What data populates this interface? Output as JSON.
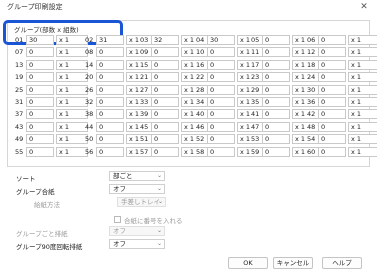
{
  "window": {
    "title": "グループ印刷設定",
    "close_glyph": "✕"
  },
  "group": {
    "legend": "グループ(部数 x 組数)",
    "rows": [
      [
        {
          "n": "01",
          "a": "30",
          "b": "x 1"
        },
        {
          "n": "02",
          "a": "31",
          "b": "x 1"
        },
        {
          "n": "03",
          "a": "32",
          "b": "x 1"
        },
        {
          "n": "04",
          "a": "30",
          "b": "x 1"
        },
        {
          "n": "05",
          "a": "0",
          "b": "x 1"
        },
        {
          "n": "06",
          "a": "0",
          "b": "x 1"
        }
      ],
      [
        {
          "n": "07",
          "a": "0",
          "b": "x 1"
        },
        {
          "n": "08",
          "a": "0",
          "b": "x 1"
        },
        {
          "n": "09",
          "a": "0",
          "b": "x 1"
        },
        {
          "n": "10",
          "a": "0",
          "b": "x 1"
        },
        {
          "n": "11",
          "a": "0",
          "b": "x 1"
        },
        {
          "n": "12",
          "a": "0",
          "b": "x 1"
        }
      ],
      [
        {
          "n": "13",
          "a": "0",
          "b": "x 1"
        },
        {
          "n": "14",
          "a": "0",
          "b": "x 1"
        },
        {
          "n": "15",
          "a": "0",
          "b": "x 1"
        },
        {
          "n": "16",
          "a": "0",
          "b": "x 1"
        },
        {
          "n": "17",
          "a": "0",
          "b": "x 1"
        },
        {
          "n": "18",
          "a": "0",
          "b": "x 1"
        }
      ],
      [
        {
          "n": "19",
          "a": "0",
          "b": "x 1"
        },
        {
          "n": "20",
          "a": "0",
          "b": "x 1"
        },
        {
          "n": "21",
          "a": "0",
          "b": "x 1"
        },
        {
          "n": "22",
          "a": "0",
          "b": "x 1"
        },
        {
          "n": "23",
          "a": "0",
          "b": "x 1"
        },
        {
          "n": "24",
          "a": "0",
          "b": "x 1"
        }
      ],
      [
        {
          "n": "25",
          "a": "0",
          "b": "x 1"
        },
        {
          "n": "26",
          "a": "0",
          "b": "x 1"
        },
        {
          "n": "27",
          "a": "0",
          "b": "x 1"
        },
        {
          "n": "28",
          "a": "0",
          "b": "x 1"
        },
        {
          "n": "29",
          "a": "0",
          "b": "x 1"
        },
        {
          "n": "30",
          "a": "0",
          "b": "x 1"
        }
      ],
      [
        {
          "n": "31",
          "a": "0",
          "b": "x 1"
        },
        {
          "n": "32",
          "a": "0",
          "b": "x 1"
        },
        {
          "n": "33",
          "a": "0",
          "b": "x 1"
        },
        {
          "n": "34",
          "a": "0",
          "b": "x 1"
        },
        {
          "n": "35",
          "a": "0",
          "b": "x 1"
        },
        {
          "n": "36",
          "a": "0",
          "b": "x 1"
        }
      ],
      [
        {
          "n": "37",
          "a": "0",
          "b": "x 1"
        },
        {
          "n": "38",
          "a": "0",
          "b": "x 1"
        },
        {
          "n": "39",
          "a": "0",
          "b": "x 1"
        },
        {
          "n": "40",
          "a": "0",
          "b": "x 1"
        },
        {
          "n": "41",
          "a": "0",
          "b": "x 1"
        },
        {
          "n": "42",
          "a": "0",
          "b": "x 1"
        }
      ],
      [
        {
          "n": "43",
          "a": "0",
          "b": "x 1"
        },
        {
          "n": "44",
          "a": "0",
          "b": "x 1"
        },
        {
          "n": "45",
          "a": "0",
          "b": "x 1"
        },
        {
          "n": "46",
          "a": "0",
          "b": "x 1"
        },
        {
          "n": "47",
          "a": "0",
          "b": "x 1"
        },
        {
          "n": "48",
          "a": "0",
          "b": "x 1"
        }
      ],
      [
        {
          "n": "49",
          "a": "0",
          "b": "x 1"
        },
        {
          "n": "50",
          "a": "0",
          "b": "x 1"
        },
        {
          "n": "51",
          "a": "0",
          "b": "x 1"
        },
        {
          "n": "52",
          "a": "0",
          "b": "x 1"
        },
        {
          "n": "53",
          "a": "0",
          "b": "x 1"
        },
        {
          "n": "54",
          "a": "0",
          "b": "x 1"
        }
      ],
      [
        {
          "n": "55",
          "a": "0",
          "b": "x 1"
        },
        {
          "n": "56",
          "a": "0",
          "b": "x 1"
        },
        {
          "n": "57",
          "a": "0",
          "b": "x 1"
        },
        {
          "n": "58",
          "a": "0",
          "b": "x 1"
        },
        {
          "n": "59",
          "a": "0",
          "b": "x 1"
        },
        {
          "n": "60",
          "a": "0",
          "b": "x 1"
        }
      ]
    ]
  },
  "settings": {
    "sort_label": "ソート",
    "sort_value": "部ごと",
    "sheet_label": "グループ合紙",
    "sheet_value": "オフ",
    "paper_source_label": "給紙方法",
    "paper_source_value": "手差しトレイ",
    "number_check_label": "合紙に番号を入れる",
    "staple_label": "グループごと排紙",
    "staple_value": "オフ",
    "rotate_label": "グループ90度回転排紙",
    "rotate_value": "オフ",
    "chevron": "⌄"
  },
  "buttons": {
    "ok": "OK",
    "cancel": "キャンセル",
    "help": "ヘルプ"
  }
}
